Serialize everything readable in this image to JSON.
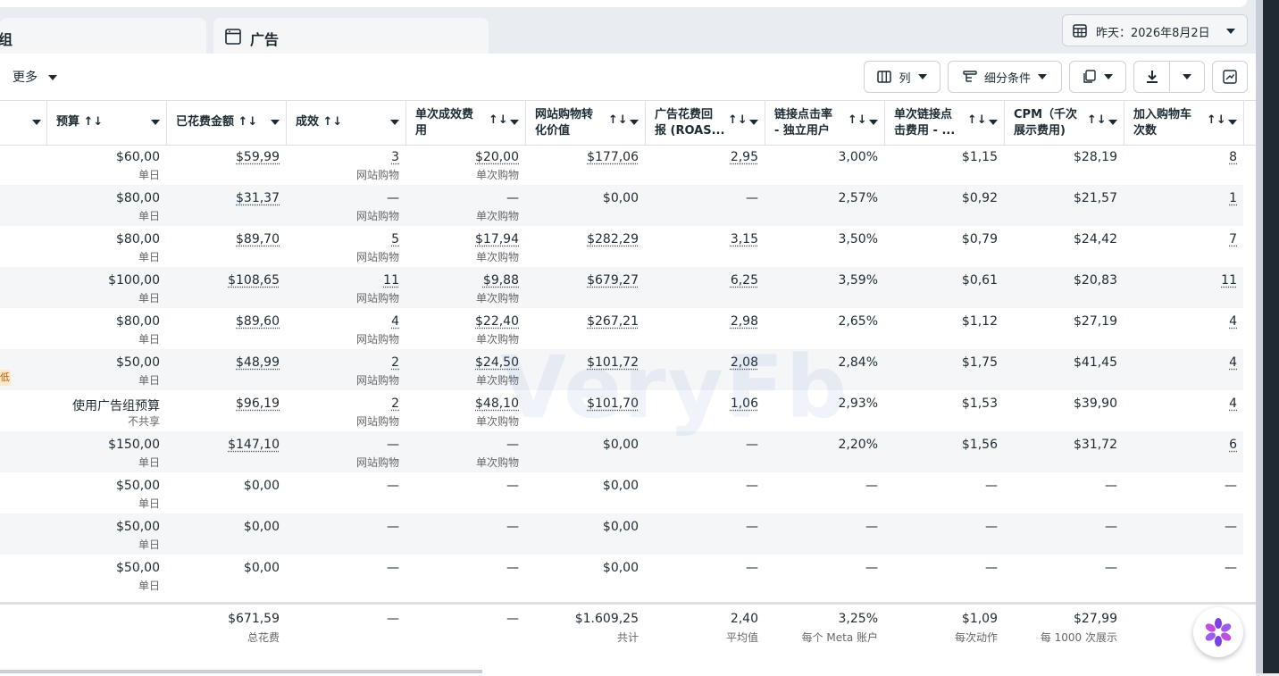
{
  "tabs": [
    {
      "label": "组"
    },
    {
      "label": "广告"
    }
  ],
  "date_picker": {
    "label": "昨天：2026年8月2日"
  },
  "toolbar": {
    "more_label": "更多",
    "columns_label": "列",
    "breakdown_label": "细分条件"
  },
  "columns": [
    {
      "label": ""
    },
    {
      "label": "预算 ↑↓"
    },
    {
      "label": "已花费金额 ↑↓"
    },
    {
      "label": "成效 ↑↓"
    },
    {
      "label": "单次成效费",
      "label2": "用"
    },
    {
      "label": "网站购物转",
      "label2": "化价值"
    },
    {
      "label": "广告花费回",
      "label2": "报 (ROAS..."
    },
    {
      "label": "链接点击率",
      "label2": "- 独立用户"
    },
    {
      "label": "单次链接点",
      "label2": "击费用 - ..."
    },
    {
      "label": "CPM（千次",
      "label2": "展示费用)"
    },
    {
      "label": "加入购物车",
      "label2": "次数"
    }
  ],
  "sort_icon": "↑↓",
  "rows": [
    {
      "budget": "$60,00",
      "budget_sub": "单日",
      "spent": "$59,99",
      "results": "3",
      "results_sub": "网站购物",
      "cpr": "$20,00",
      "cpr_sub": "单次购物",
      "value": "$177,06",
      "roas": "2,95",
      "ctr": "3,00%",
      "cpc": "$1,15",
      "cpm": "$28,19",
      "atc": "8"
    },
    {
      "budget": "$80,00",
      "budget_sub": "单日",
      "spent": "$31,37",
      "results": "—",
      "results_sub": "网站购物",
      "cpr": "—",
      "cpr_sub": "单次购物",
      "value": "$0,00",
      "roas": "—",
      "ctr": "2,57%",
      "cpc": "$0,92",
      "cpm": "$21,57",
      "atc": "1"
    },
    {
      "budget": "$80,00",
      "budget_sub": "单日",
      "spent": "$89,70",
      "results": "5",
      "results_sub": "网站购物",
      "cpr": "$17,94",
      "cpr_sub": "单次购物",
      "value": "$282,29",
      "roas": "3,15",
      "ctr": "3,50%",
      "cpc": "$0,79",
      "cpm": "$24,42",
      "atc": "7"
    },
    {
      "budget": "$100,00",
      "budget_sub": "单日",
      "spent": "$108,65",
      "results": "11",
      "results_sub": "网站购物",
      "cpr": "$9,88",
      "cpr_sub": "单次购物",
      "value": "$679,27",
      "roas": "6,25",
      "ctr": "3,59%",
      "cpc": "$0,61",
      "cpm": "$20,83",
      "atc": "11"
    },
    {
      "budget": "$80,00",
      "budget_sub": "单日",
      "spent": "$89,60",
      "results": "4",
      "results_sub": "网站购物",
      "cpr": "$22,40",
      "cpr_sub": "单次购物",
      "value": "$267,21",
      "roas": "2,98",
      "ctr": "2,65%",
      "cpc": "$1,12",
      "cpm": "$27,19",
      "atc": "4"
    },
    {
      "budget": "$50,00",
      "budget_sub": "单日",
      "spent": "$48,99",
      "results": "2",
      "results_sub": "网站购物",
      "cpr": "$24,50",
      "cpr_sub": "单次购物",
      "value": "$101,72",
      "roas": "2,08",
      "ctr": "2,84%",
      "cpc": "$1,75",
      "cpm": "$41,45",
      "atc": "4"
    },
    {
      "budget": "使用广告组预算",
      "budget_sub": "不共享",
      "spent": "$96,19",
      "results": "2",
      "results_sub": "网站购物",
      "cpr": "$48,10",
      "cpr_sub": "单次购物",
      "value": "$101,70",
      "roas": "1,06",
      "ctr": "2,93%",
      "cpc": "$1,53",
      "cpm": "$39,90",
      "atc": "4"
    },
    {
      "budget": "$150,00",
      "budget_sub": "单日",
      "spent": "$147,10",
      "results": "—",
      "results_sub": "网站购物",
      "cpr": "—",
      "cpr_sub": "单次购物",
      "value": "$0,00",
      "roas": "—",
      "ctr": "2,20%",
      "cpc": "$1,56",
      "cpm": "$31,72",
      "atc": "6"
    },
    {
      "budget": "$50,00",
      "budget_sub": "单日",
      "spent": "$0,00",
      "results": "—",
      "results_sub": "",
      "cpr": "—",
      "cpr_sub": "",
      "value": "$0,00",
      "roas": "—",
      "ctr": "—",
      "cpc": "—",
      "cpm": "—",
      "atc": "—"
    },
    {
      "budget": "$50,00",
      "budget_sub": "单日",
      "spent": "$0,00",
      "results": "—",
      "results_sub": "",
      "cpr": "—",
      "cpr_sub": "",
      "value": "$0,00",
      "roas": "—",
      "ctr": "—",
      "cpc": "—",
      "cpm": "—",
      "atc": "—"
    },
    {
      "budget": "$50,00",
      "budget_sub": "单日",
      "spent": "$0,00",
      "results": "—",
      "results_sub": "",
      "cpr": "—",
      "cpr_sub": "",
      "value": "$0,00",
      "roas": "—",
      "ctr": "—",
      "cpc": "—",
      "cpm": "—",
      "atc": "—"
    }
  ],
  "row_tag": "低",
  "totals": {
    "spent": "$671,59",
    "spent_sub": "总花费",
    "results": "—",
    "cpr": "—",
    "value": "$1.609,25",
    "value_sub": "共计",
    "roas": "2,40",
    "roas_sub": "平均值",
    "ctr": "3,25%",
    "ctr_sub": "每个 Meta 账户",
    "cpc": "$1,09",
    "cpc_sub": "每次动作",
    "cpm": "$27,99",
    "cpm_sub": "每 1000 次展示"
  },
  "watermark": "VeryFb",
  "colors": {
    "accent": "#1c2b33",
    "border": "#dddfe2",
    "alt_row": "#f5f6f7",
    "muted": "#65676b"
  }
}
